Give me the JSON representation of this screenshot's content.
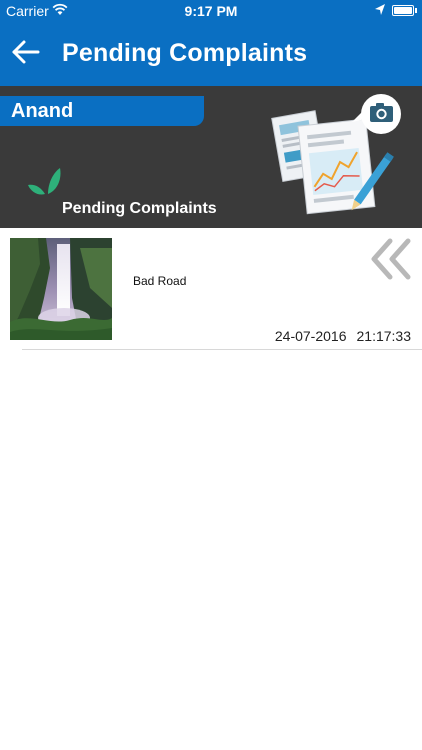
{
  "status_bar": {
    "carrier": "Carrier",
    "time": "9:17 PM",
    "icons": [
      "wifi-icon",
      "location-arrow-icon",
      "battery-icon"
    ],
    "battery_level": 1.0
  },
  "nav": {
    "title": "Pending Complaints",
    "back_icon": "back-arrow-icon",
    "color": "#0a6fc2"
  },
  "banner": {
    "user_name": "Anand",
    "subtitle": "Pending Complaints",
    "background": "#3a3a3a",
    "icons": [
      "leaf-icon",
      "documents-chart-illustration",
      "camera-icon"
    ]
  },
  "complaints": [
    {
      "description": "Bad Road",
      "date": "24-07-2016",
      "time": "21:17:33",
      "thumbnail": "waterfall-photo",
      "action_icon": "double-chevron-left-icon"
    }
  ]
}
